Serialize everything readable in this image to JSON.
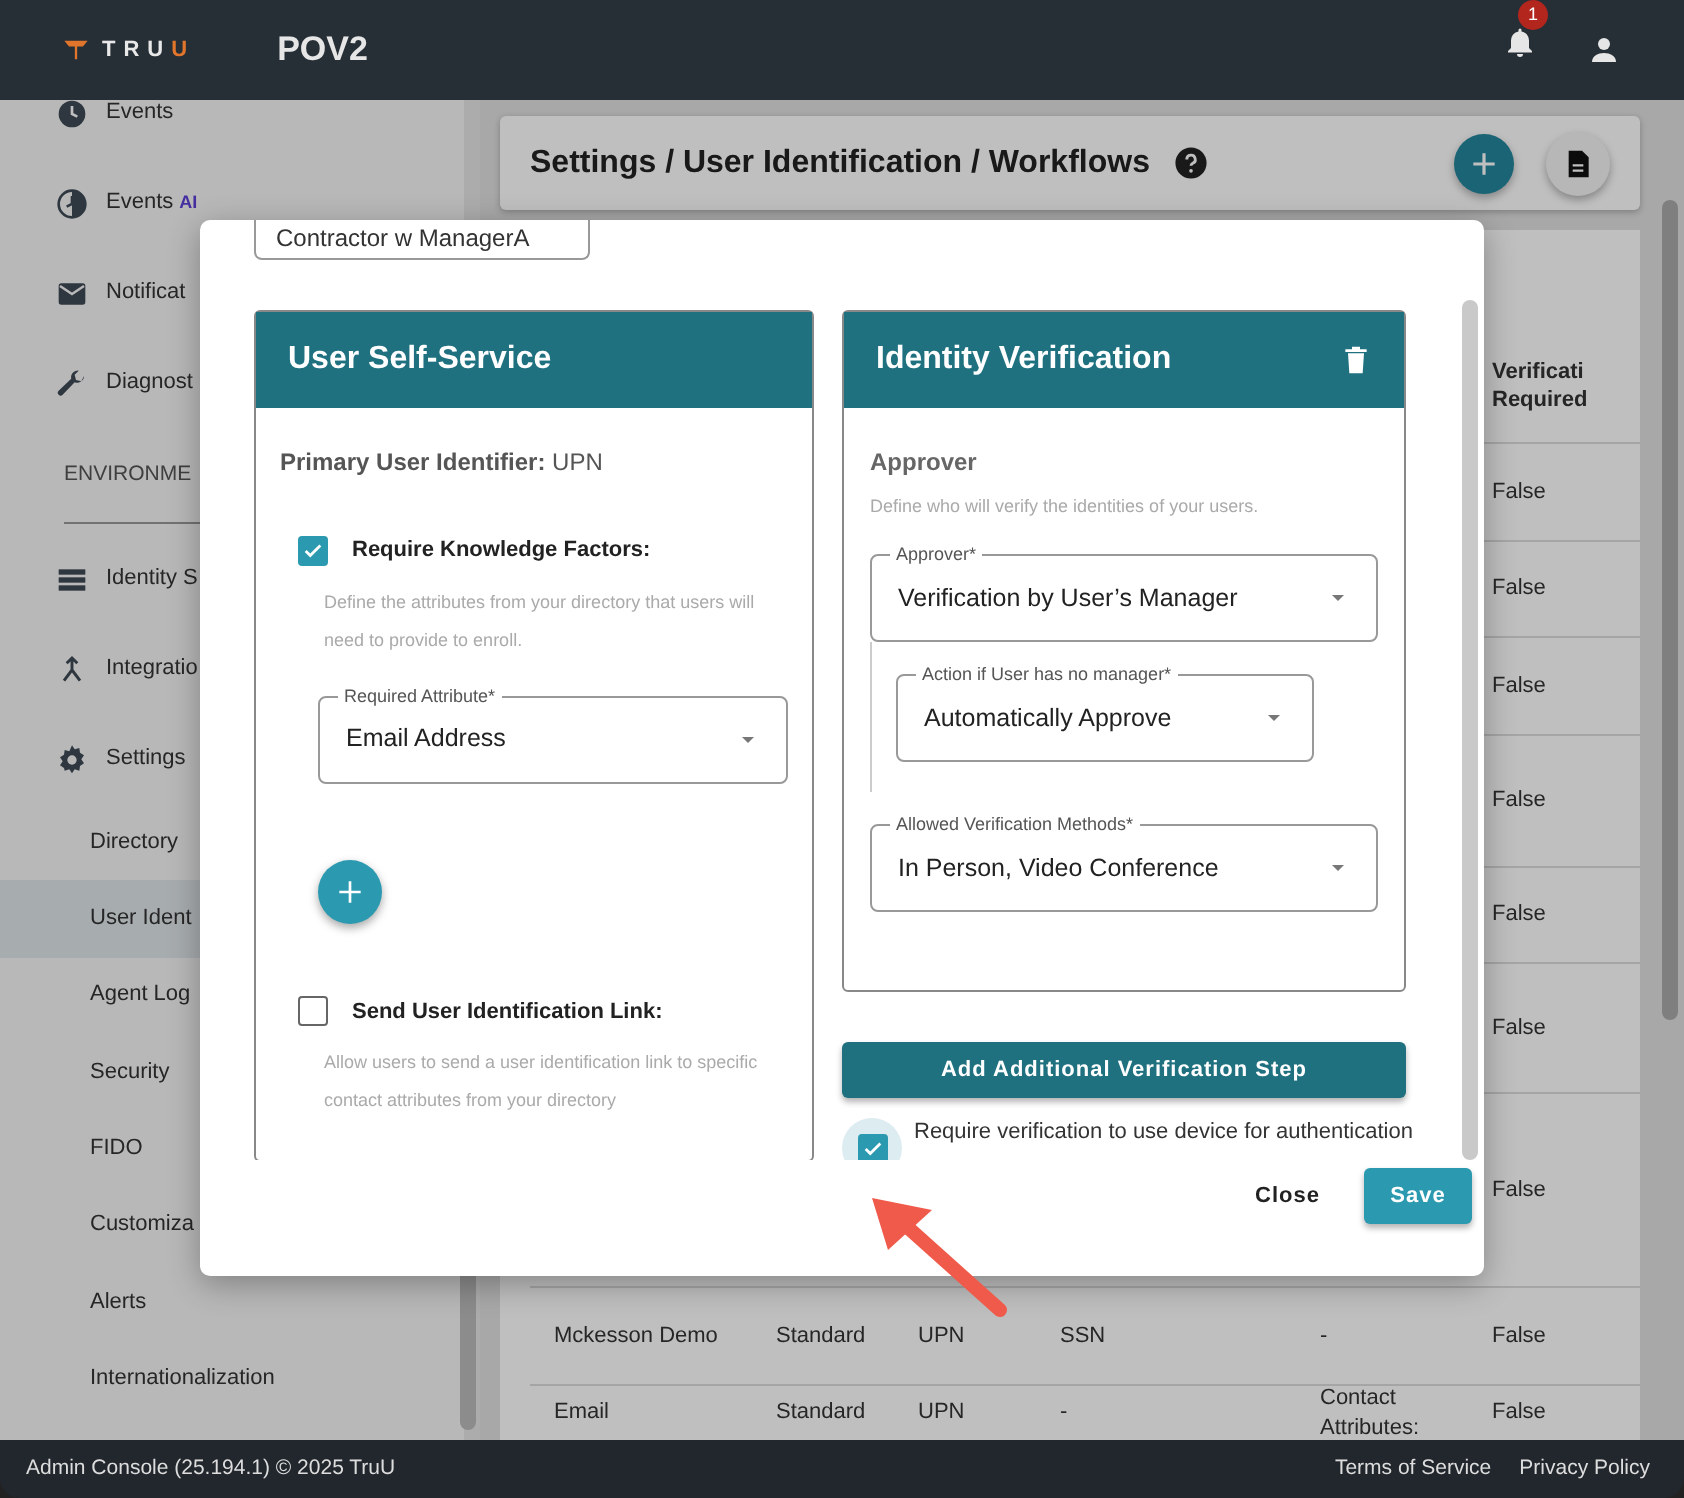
{
  "topbar": {
    "brand": "TRUU",
    "title": "POV2",
    "notification_count": "1"
  },
  "sidebar": {
    "items": [
      {
        "kind": "item",
        "label": "Events",
        "selected": false
      },
      {
        "kind": "item",
        "label": "Events",
        "badge": "AI",
        "selected": false
      },
      {
        "kind": "item",
        "label": "Notificat",
        "selected": false
      },
      {
        "kind": "item",
        "label": "Diagnost",
        "selected": false
      },
      {
        "kind": "section",
        "label": "ENVIRONME"
      },
      {
        "kind": "item",
        "label": "Identity S",
        "selected": false
      },
      {
        "kind": "item",
        "label": "Integratio",
        "selected": false
      },
      {
        "kind": "item",
        "label": "Settings",
        "selected": false
      },
      {
        "kind": "subitem",
        "label": "Directory",
        "selected": false
      },
      {
        "kind": "subitem",
        "label": "User Ident",
        "selected": true
      },
      {
        "kind": "subitem",
        "label": "Agent Log",
        "selected": false
      },
      {
        "kind": "subitem",
        "label": "Security",
        "selected": false
      },
      {
        "kind": "subitem",
        "label": "FIDO",
        "selected": false
      },
      {
        "kind": "subitem",
        "label": "Customiza",
        "selected": false
      },
      {
        "kind": "subitem",
        "label": "Alerts",
        "selected": false
      },
      {
        "kind": "subitem",
        "label": "Internationalization",
        "selected": false
      }
    ]
  },
  "main": {
    "breadcrumb": "Settings / User Identification / Workflows",
    "table": {
      "header": {
        "column_6": "Verificati Required"
      },
      "rows": [
        {
          "column_6": "False"
        },
        {
          "column_6": "False"
        },
        {
          "column_6": "False"
        },
        {
          "column_6": "False"
        },
        {
          "column_6": "False"
        },
        {
          "column_6": "False"
        },
        {
          "column_6": "False"
        },
        {
          "column_1": "Mckesson Demo",
          "column_2": "Standard",
          "column_3": "UPN",
          "column_4": "SSN",
          "column_5": "-",
          "column_6": "False"
        },
        {
          "column_1": "Email",
          "column_2": "Standard",
          "column_3": "UPN",
          "column_4": "-",
          "column_5": "Contact Attributes:",
          "column_6": "False"
        }
      ]
    }
  },
  "modal": {
    "workflow_name": "Contractor w ManagerA",
    "self_service": {
      "title": "User Self-Service",
      "primary_identifier": "**Primary User Identifier:** UPN",
      "options": [
        {
          "label": "Require Knowledge Factors:",
          "checked": true,
          "help": "Define the attributes from your directory that users will need to provide to enroll.",
          "fields": [
            {
              "label": "Required Attribute*",
              "value": "Email Address"
            }
          ],
          "add_button": true
        },
        {
          "label": "Send User Identification Link:",
          "checked": false,
          "help": "Allow users to send a user identification link to specific contact attributes from your directory",
          "add_button": false
        }
      ]
    },
    "identity_verification": {
      "title": "Identity Verification",
      "section": "Approver",
      "help": "Define who will verify the identities of your users.",
      "fields": [
        {
          "label": "Approver*",
          "value": "Verification by User’s Manager",
          "nested": false
        },
        {
          "label": "Action if User has no manager*",
          "value": "Automatically Approve",
          "nested": true
        },
        {
          "label": "Allowed Verification Methods*",
          "value": "In Person, Video Conference",
          "nested": false
        }
      ]
    },
    "add_step_button": "Add Additional Verification Step",
    "device_verification": {
      "label": "Require verification to use device for authentication",
      "checked": true
    },
    "buttons": [
      {
        "label": "Close",
        "kind": "text"
      },
      {
        "label": "Save",
        "kind": "primary"
      }
    ]
  },
  "footer": {
    "copyright": "Admin Console (25.194.1) © 2025 TruU",
    "links": [
      "Terms of Service",
      "Privacy Policy"
    ]
  }
}
